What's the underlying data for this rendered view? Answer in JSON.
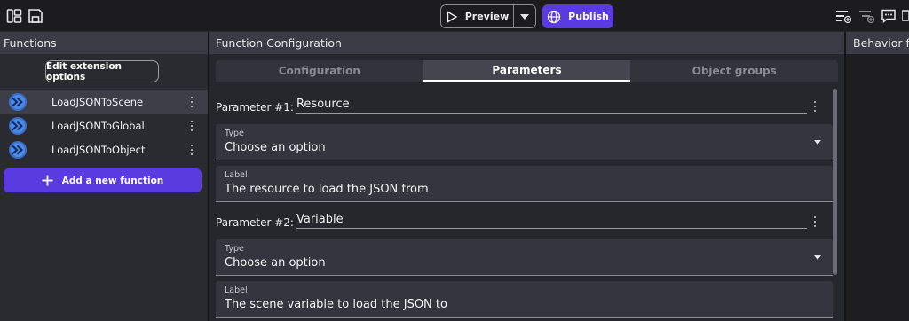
{
  "toolbar": {
    "preview_label": "Preview",
    "publish_label": "Publish"
  },
  "left_panel": {
    "title": "Functions",
    "edit_extension_label": "Edit extension options",
    "functions": [
      {
        "label": "LoadJSONToScene",
        "selected": true
      },
      {
        "label": "LoadJSONToGlobal",
        "selected": false
      },
      {
        "label": "LoadJSONToObject",
        "selected": false
      }
    ],
    "add_function_label": "Add a new function"
  },
  "main": {
    "title": "Function Configuration",
    "tabs": [
      {
        "label": "Configuration",
        "active": false
      },
      {
        "label": "Parameters",
        "active": true
      },
      {
        "label": "Object groups",
        "active": false
      }
    ],
    "parameters": [
      {
        "heading": "Parameter #1:",
        "name": "Resource",
        "type_label": "Type",
        "type_value": "Choose an option",
        "label_label": "Label",
        "label_value": "The resource to load the JSON from"
      },
      {
        "heading": "Parameter #2:",
        "name": "Variable",
        "type_label": "Type",
        "type_value": "Choose an option",
        "label_label": "Label",
        "label_value": "The scene variable to load the JSON to"
      }
    ]
  },
  "right_panel": {
    "title": "Behavior fu"
  },
  "colors": {
    "accent": "#5a3be0",
    "panel_header": "#3a3b44",
    "background": "#1b1b1e"
  }
}
